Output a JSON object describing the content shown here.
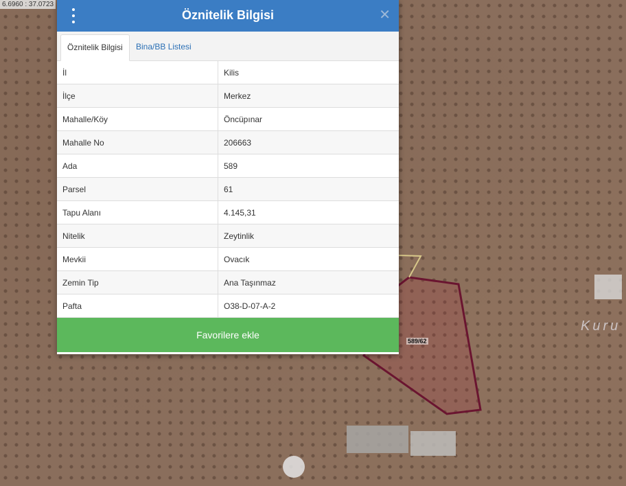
{
  "map": {
    "coordinates": "6.6960 : 37.0723",
    "parcel_label": "589/62",
    "place_label": "Kuru"
  },
  "panel": {
    "title": "Öznitelik Bilgisi",
    "menu_icon": "vertical-dots-icon",
    "close_icon": "close-icon",
    "close_label": "✕",
    "tabs": [
      {
        "label": "Öznitelik Bilgisi",
        "active": true
      },
      {
        "label": "Bina/BB Listesi",
        "active": false
      }
    ],
    "rows": [
      {
        "key": "İl",
        "value": "Kilis"
      },
      {
        "key": "İlçe",
        "value": "Merkez"
      },
      {
        "key": "Mahalle/Köy",
        "value": "Öncüpınar"
      },
      {
        "key": "Mahalle No",
        "value": "206663"
      },
      {
        "key": "Ada",
        "value": "589"
      },
      {
        "key": "Parsel",
        "value": "61"
      },
      {
        "key": "Tapu Alanı",
        "value": "4.145,31"
      },
      {
        "key": "Nitelik",
        "value": "Zeytinlik"
      },
      {
        "key": "Mevkii",
        "value": "Ovacık"
      },
      {
        "key": "Zemin Tip",
        "value": "Ana Taşınmaz"
      },
      {
        "key": "Pafta",
        "value": "O38-D-07-A-2"
      }
    ],
    "favorite_button": "Favorilere ekle"
  },
  "colors": {
    "header": "#3b7dc4",
    "button": "#5cb85c",
    "parcel_outline": "#6a1530"
  }
}
